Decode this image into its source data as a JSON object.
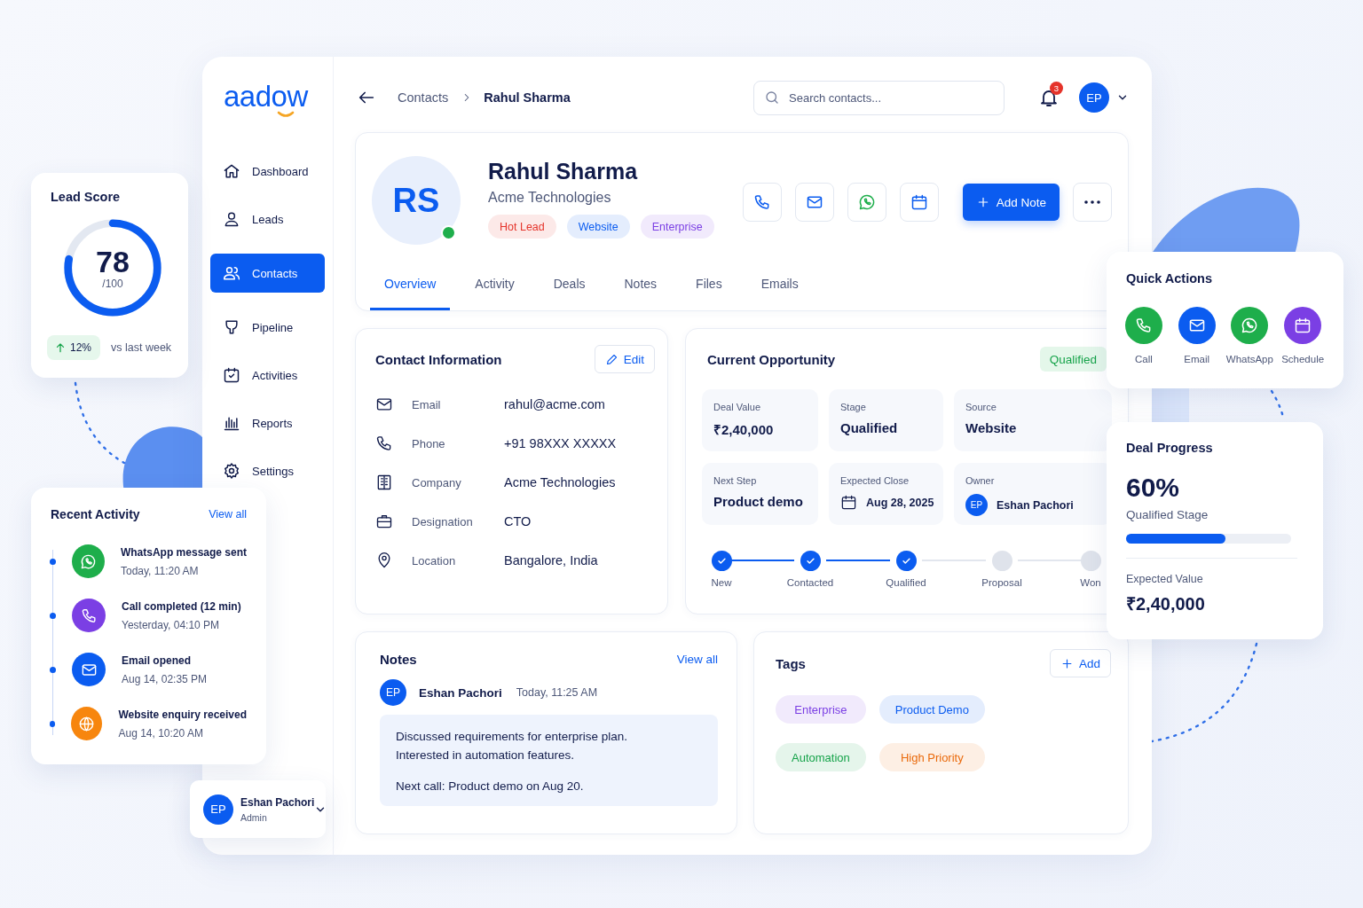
{
  "app": {
    "logo": "aadow"
  },
  "sidebar": {
    "items": [
      {
        "kind": "dashboard",
        "label": "Dashboard",
        "selected": false
      },
      {
        "kind": "leads",
        "label": "Leads",
        "selected": false
      },
      {
        "kind": "contacts",
        "label": "Contacts",
        "selected": true
      },
      {
        "kind": "pipeline",
        "label": "Pipeline",
        "selected": false
      },
      {
        "kind": "activities",
        "label": "Activities",
        "selected": false
      },
      {
        "kind": "reports",
        "label": "Reports",
        "selected": false
      },
      {
        "kind": "settings",
        "label": "Settings",
        "selected": false
      }
    ],
    "user": {
      "initials": "EP",
      "name": "Eshan Pachori",
      "role": "Admin"
    }
  },
  "header": {
    "breadcrumb": [
      "Contacts",
      "Rahul Sharma"
    ],
    "search": {
      "placeholder": "Search contacts..."
    },
    "notifications": "3",
    "avatar": "EP"
  },
  "profile": {
    "initials": "RS",
    "online": true,
    "name": "Rahul Sharma",
    "company": "Acme Technologies",
    "tags": [
      {
        "label": "Hot Lead",
        "color": "#e5332a"
      },
      {
        "label": "Website",
        "color": "#0b5cf0"
      },
      {
        "label": "Enterprise",
        "color": "#7b3fe4"
      }
    ],
    "actions": [
      {
        "kind": "call"
      },
      {
        "kind": "email"
      },
      {
        "kind": "whatsapp"
      },
      {
        "kind": "schedule"
      }
    ],
    "primary_button": "Add Note"
  },
  "tabs": [
    {
      "label": "Overview",
      "selected": true
    },
    {
      "label": "Activity",
      "selected": false
    },
    {
      "label": "Deals",
      "selected": false
    },
    {
      "label": "Notes",
      "selected": false
    },
    {
      "label": "Files",
      "selected": false
    },
    {
      "label": "Emails",
      "selected": false
    }
  ],
  "contact_info": {
    "title": "Contact Information",
    "edit": "Edit",
    "fields": [
      {
        "kind": "email",
        "label": "Email",
        "value": "rahul@acme.com"
      },
      {
        "kind": "phone",
        "label": "Phone",
        "value": "+91 98XXX XXXXX"
      },
      {
        "kind": "company",
        "label": "Company",
        "value": "Acme Technologies"
      },
      {
        "kind": "designation",
        "label": "Designation",
        "value": "CTO"
      },
      {
        "kind": "location",
        "label": "Location",
        "value": "Bangalore, India"
      }
    ]
  },
  "opportunity": {
    "title": "Current Opportunity",
    "status": "Qualified",
    "cells": [
      {
        "kind": "text",
        "label": "Deal Value",
        "value": "₹2,40,000"
      },
      {
        "kind": "text",
        "label": "Stage",
        "value": "Qualified"
      },
      {
        "kind": "text",
        "label": "Source",
        "value": "Website"
      },
      {
        "kind": "text",
        "label": "Next Step",
        "value": "Product demo"
      },
      {
        "kind": "date",
        "label": "Expected Close",
        "value": "Aug 28, 2025"
      },
      {
        "kind": "owner",
        "label": "Owner",
        "initials": "EP",
        "value": "Eshan Pachori"
      }
    ],
    "stages": [
      {
        "label": "New",
        "done": true
      },
      {
        "label": "Contacted",
        "done": true
      },
      {
        "label": "Qualified",
        "done": true
      },
      {
        "label": "Proposal",
        "done": false
      },
      {
        "label": "Won",
        "done": false
      }
    ]
  },
  "notes": {
    "title": "Notes",
    "view_all": "View all",
    "author": {
      "initials": "EP",
      "name": "Eshan Pachori"
    },
    "time": "Today, 11:25 AM",
    "paragraphs": [
      [
        "Discussed requirements for enterprise plan.",
        "Interested in automation features."
      ],
      [
        "Next call: Product demo on Aug 20."
      ]
    ]
  },
  "tags_card": {
    "title": "Tags",
    "add": "Add",
    "tags": [
      {
        "label": "Enterprise",
        "color": "#7b3fe4"
      },
      {
        "label": "Product Demo",
        "color": "#0b5cf0"
      },
      {
        "label": "Automation",
        "color": "#16a34a"
      },
      {
        "label": "High Priority",
        "color": "#ea6a0c"
      }
    ]
  },
  "lead_score": {
    "title": "Lead Score",
    "score": "78",
    "max": "/100",
    "level": 0.78,
    "change": "12%",
    "comparison": "vs last week"
  },
  "recent_activity": {
    "title": "Recent Activity",
    "view_all": "View all",
    "items": [
      {
        "kind": "whatsapp",
        "title": "WhatsApp message sent",
        "time": "Today, 11:20 AM"
      },
      {
        "kind": "call",
        "title": "Call completed (12 min)",
        "time": "Yesterday, 04:10 PM"
      },
      {
        "kind": "email",
        "title": "Email opened",
        "time": "Aug 14, 02:35 PM"
      },
      {
        "kind": "website",
        "title": "Website enquiry received",
        "time": "Aug 14, 10:20 AM"
      }
    ]
  },
  "quick_actions": {
    "title": "Quick Actions",
    "actions": [
      {
        "kind": "call",
        "label": "Call"
      },
      {
        "kind": "email",
        "label": "Email"
      },
      {
        "kind": "whatsapp",
        "label": "WhatsApp"
      },
      {
        "kind": "schedule",
        "label": "Schedule"
      }
    ]
  },
  "deal_progress": {
    "title": "Deal Progress",
    "percent": "60%",
    "stage": "Qualified Stage",
    "level": 0.6,
    "expected_label": "Expected Value",
    "expected_value": "₹2,40,000"
  }
}
